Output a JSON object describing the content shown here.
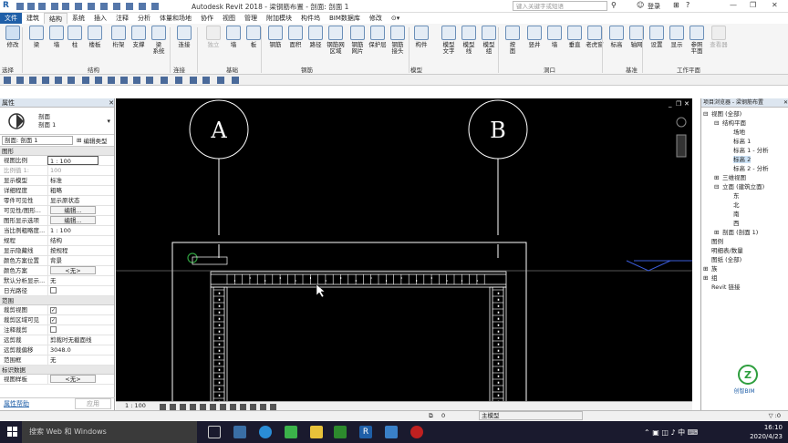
{
  "app": {
    "logo": "R",
    "title": "Autodesk Revit 2018 -  梁钢筋布置 - 剖面: 剖面 1",
    "search_placeholder": "键入关键字或短语",
    "login": "登录"
  },
  "menu_tabs": [
    "文件",
    "建筑",
    "结构",
    "系统",
    "插入",
    "注释",
    "分析",
    "体量和场地",
    "协作",
    "视图",
    "管理",
    "附加模块",
    "构件坞",
    "BIM数据库",
    "修改"
  ],
  "active_tab": "结构",
  "ribbon": {
    "buttons": [
      {
        "label": "修改",
        "name": "modify",
        "icon": "cursor-icon"
      },
      {
        "label": "梁",
        "name": "beam",
        "icon": "beam-icon"
      },
      {
        "label": "墙",
        "name": "wall",
        "icon": "wall-icon"
      },
      {
        "label": "柱",
        "name": "column",
        "icon": "column-icon"
      },
      {
        "label": "楼板",
        "name": "floor",
        "icon": "floor-icon"
      },
      {
        "label": "桁架",
        "name": "truss",
        "icon": "truss-icon"
      },
      {
        "label": "支撑",
        "name": "brace",
        "icon": "brace-icon"
      },
      {
        "label": "梁\n系统",
        "name": "beam-system",
        "icon": "beam-system-icon"
      },
      {
        "label": "连接",
        "name": "connection",
        "icon": "connection-icon"
      },
      {
        "label": "独立",
        "name": "isolated",
        "icon": "isolated-icon",
        "disabled": true
      },
      {
        "label": "墙",
        "name": "wall-foundation",
        "icon": "wall-foundation-icon"
      },
      {
        "label": "板",
        "name": "slab",
        "icon": "slab-icon"
      },
      {
        "label": "钢筋",
        "name": "rebar",
        "icon": "rebar-icon"
      },
      {
        "label": "面积",
        "name": "area",
        "icon": "area-icon"
      },
      {
        "label": "路径",
        "name": "path",
        "icon": "path-icon"
      },
      {
        "label": "钢筋网\n区域",
        "name": "fabric-area",
        "icon": "fabric-area-icon"
      },
      {
        "label": "钢筋\n网片",
        "name": "fabric-sheet",
        "icon": "fabric-sheet-icon"
      },
      {
        "label": "保护层",
        "name": "cover",
        "icon": "cover-icon"
      },
      {
        "label": "钢筋\n接头",
        "name": "coupler",
        "icon": "coupler-icon"
      },
      {
        "label": "构件",
        "name": "component",
        "icon": "component-icon"
      },
      {
        "label": "模型\n文字",
        "name": "model-text",
        "icon": "model-text-icon"
      },
      {
        "label": "模型\n线",
        "name": "model-line",
        "icon": "model-line-icon"
      },
      {
        "label": "模型\n组",
        "name": "model-group",
        "icon": "model-group-icon"
      },
      {
        "label": "按\n面",
        "name": "by-face",
        "icon": "by-face-icon"
      },
      {
        "label": "竖井",
        "name": "shaft",
        "icon": "shaft-icon"
      },
      {
        "label": "墙",
        "name": "wall-opening",
        "icon": "wall-opening-icon"
      },
      {
        "label": "垂直",
        "name": "vertical",
        "icon": "vertical-icon"
      },
      {
        "label": "老虎窗",
        "name": "dormer",
        "icon": "dormer-icon"
      },
      {
        "label": "标高",
        "name": "level",
        "icon": "level-icon"
      },
      {
        "label": "轴网",
        "name": "grid",
        "icon": "grid-icon"
      },
      {
        "label": "设置",
        "name": "set",
        "icon": "set-icon"
      },
      {
        "label": "显示",
        "name": "show",
        "icon": "show-icon"
      },
      {
        "label": "参照\n平面",
        "name": "ref-plane",
        "icon": "ref-plane-icon"
      },
      {
        "label": "查看器",
        "name": "viewer",
        "icon": "viewer-icon",
        "disabled": true
      }
    ],
    "groups": [
      "选择",
      "结构",
      "连接",
      "基础",
      "钢筋",
      "模型",
      "洞口",
      "基准",
      "工作平面"
    ]
  },
  "properties": {
    "title": "属性",
    "type_name": "剖面",
    "type_sub": "剖面 1",
    "selector": "剖面: 剖面 1",
    "edit_type": "编辑类型",
    "sections": [
      {
        "name": "图形",
        "rows": [
          {
            "k": "视图比例",
            "v": "1 : 100",
            "kind": "input"
          },
          {
            "k": "比例值 1:",
            "v": "100",
            "kind": "dim"
          },
          {
            "k": "显示模型",
            "v": "标准"
          },
          {
            "k": "详细程度",
            "v": "粗略"
          },
          {
            "k": "零件可见性",
            "v": "显示原状态"
          },
          {
            "k": "可见性/图形...",
            "v": "编辑...",
            "kind": "btn"
          },
          {
            "k": "图形显示选项",
            "v": "编辑...",
            "kind": "btn"
          },
          {
            "k": "当比例粗略度...",
            "v": "1 : 100"
          },
          {
            "k": "规程",
            "v": "结构"
          },
          {
            "k": "显示隐藏线",
            "v": "按规程"
          },
          {
            "k": "颜色方案位置",
            "v": "背景"
          },
          {
            "k": "颜色方案",
            "v": "<无>",
            "kind": "btn"
          },
          {
            "k": "默认分析显示...",
            "v": "无"
          },
          {
            "k": "日光路径",
            "v": "",
            "kind": "cb"
          }
        ]
      },
      {
        "name": "范围",
        "rows": [
          {
            "k": "裁剪视图",
            "v": "",
            "kind": "cbc"
          },
          {
            "k": "裁剪区域可见",
            "v": "",
            "kind": "cbc"
          },
          {
            "k": "注释裁剪",
            "v": "",
            "kind": "cb"
          },
          {
            "k": "远剪裁",
            "v": "剪裁时无截面线"
          },
          {
            "k": "远剪裁偏移",
            "v": "3048.0"
          },
          {
            "k": "范围框",
            "v": "无"
          }
        ]
      },
      {
        "name": "标识数据",
        "rows": [
          {
            "k": "视图样板",
            "v": "<无>",
            "kind": "btn"
          }
        ]
      }
    ],
    "help": "属性帮助",
    "apply": "应用"
  },
  "viewport": {
    "grid_a": "A",
    "grid_b": "B",
    "scale": "1 : 100"
  },
  "browser": {
    "title": "项目浏览器 - 梁钢筋布置",
    "items": [
      {
        "t": "视图 (全部)",
        "lvl": 0,
        "exp": "⊟"
      },
      {
        "t": "结构平面",
        "lvl": 1,
        "exp": "⊟"
      },
      {
        "t": "场地",
        "lvl": 2
      },
      {
        "t": "标高 1",
        "lvl": 2
      },
      {
        "t": "标高 1 - 分析",
        "lvl": 2
      },
      {
        "t": "标高 2",
        "lvl": 2,
        "sel": true
      },
      {
        "t": "标高 2 - 分析",
        "lvl": 2
      },
      {
        "t": "三维视图",
        "lvl": 1,
        "exp": "⊞"
      },
      {
        "t": "立面 (建筑立面)",
        "lvl": 1,
        "exp": "⊟"
      },
      {
        "t": "东",
        "lvl": 2
      },
      {
        "t": "北",
        "lvl": 2
      },
      {
        "t": "南",
        "lvl": 2
      },
      {
        "t": "西",
        "lvl": 2
      },
      {
        "t": "剖面 (剖面 1)",
        "lvl": 1,
        "exp": "⊞"
      },
      {
        "t": "图例",
        "lvl": 0
      },
      {
        "t": "明细表/数量",
        "lvl": 0
      },
      {
        "t": "图纸 (全部)",
        "lvl": 0
      },
      {
        "t": "族",
        "lvl": 0,
        "exp": "⊞"
      },
      {
        "t": "组",
        "lvl": 0,
        "exp": "⊞"
      },
      {
        "t": "Revit 链接",
        "lvl": 0
      }
    ],
    "logo_text": "创智BIM"
  },
  "statusbar": {
    "coord": "0",
    "model": "主模型"
  },
  "taskbar": {
    "search": "搜索 Web 和 Windows",
    "time": "16:10",
    "date": "2020/4/23"
  },
  "colors": {
    "accent": "#1f5fa8",
    "viewport_bg": "#000000",
    "cad_line": "#ffffff",
    "origin_marker": "#2e9e3e"
  }
}
